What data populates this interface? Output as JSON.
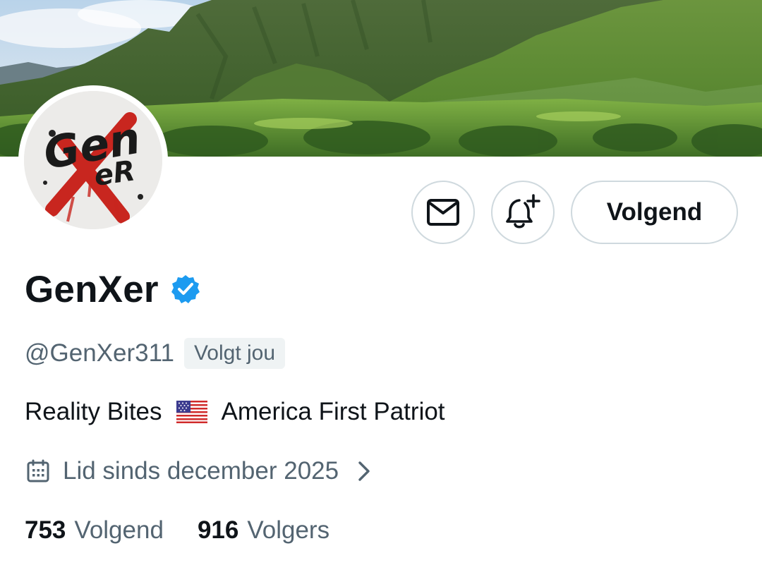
{
  "profile": {
    "display_name": "GenXer",
    "handle": "@GenXer311",
    "follows_you_badge": "Volgt jou",
    "verified_icon": "verified-badge-icon",
    "avatar_text": "GenXer",
    "bio": {
      "part1": "Reality Bites",
      "flag_icon": "us-flag-icon",
      "part2": "America First Patriot"
    },
    "joined": "Lid sinds december 2025"
  },
  "actions": {
    "message_icon": "mail-icon",
    "notify_icon": "bell-plus-icon",
    "follow_label": "Volgend"
  },
  "stats": {
    "following_count": "753",
    "following_label": "Volgend",
    "followers_count": "916",
    "followers_label": "Volgers"
  },
  "colors": {
    "verified_blue": "#1d9bf0",
    "text_primary": "#0f1419",
    "text_secondary": "#536471",
    "border": "#cfd9de",
    "badge_bg": "#eff3f4"
  }
}
